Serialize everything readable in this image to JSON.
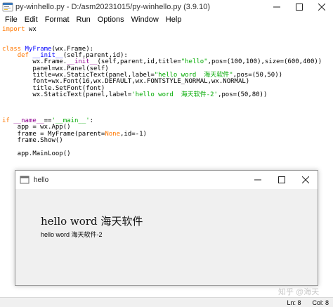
{
  "window": {
    "title": "py-winhello.py - D:/asm20231015/py-winhello.py (3.9.10)"
  },
  "menu": [
    "File",
    "Edit",
    "Format",
    "Run",
    "Options",
    "Window",
    "Help"
  ],
  "code_lines": [
    "import wx",
    "",
    "",
    "class MyFrame(wx.Frame):",
    "    def __init__(self,parent,id):",
    "        wx.Frame.__init__(self,parent,id,title=\"hello\",pos=(100,100),size=(600,400))",
    "        panel=wx.Panel(self)",
    "        title=wx.StaticText(panel,label=\"hello word  海天软件\",pos=(50,50))",
    "        font=wx.Font(16,wx.DEFAULT,wx.FONTSTYLE_NORMAL,wx.NORMAL)",
    "        title.SetFont(font)",
    "        wx.StaticText(panel,label='hello word  海天软件-2',pos=(50,80))",
    "",
    "",
    "",
    "if __name__=='__main__':",
    "    app = wx.App()",
    "    frame = MyFrame(parent=None,id=-1)",
    "    frame.Show()",
    "",
    "    app.MainLoop()"
  ],
  "status": {
    "line": "Ln: 8",
    "col": "Col: 8"
  },
  "frame": {
    "title": "hello",
    "label_big": "hello word   海天软件",
    "label_small": "hello word  海天软件-2"
  },
  "watermark": "知乎 @海天",
  "colors": {
    "keyword": "#ff7700",
    "definition": "#0000ff",
    "string": "#00aa00",
    "builtin": "#900090"
  }
}
